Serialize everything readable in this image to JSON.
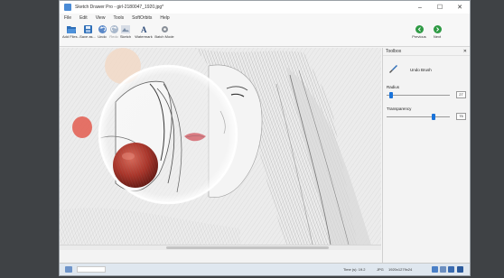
{
  "window": {
    "title": "Sketch Drawer Pro - girl-2180047_1920.jpg*",
    "controls": {
      "minimize": "–",
      "maximize": "☐",
      "close": "✕"
    }
  },
  "menu": [
    "File",
    "Edit",
    "View",
    "Tools",
    "SoftOrbits",
    "Help"
  ],
  "toolbar": {
    "add_files": "Add Files...",
    "save_as": "Save as...",
    "undo": "Undo",
    "redo": "Redo",
    "sketch": "Sketch",
    "watermark": "Watermark",
    "batch_mode": "Batch Mode",
    "previous": "Previous",
    "next": "Next"
  },
  "toolbox": {
    "title": "Toolbox",
    "close": "✕",
    "brush_name": "Undo Brush",
    "radius_label": "Radius",
    "radius_value": "27",
    "radius_level": 0.05,
    "transparency_label": "Transparency",
    "transparency_value": "75",
    "transparency_level": 0.75
  },
  "status": {
    "time": "Time (s): 19.2",
    "format": "JPG",
    "dimensions": "1920x1279x24"
  },
  "colors": {
    "accent": "#1a73d9",
    "nav_green": "#2e9a44",
    "desktop": "#3f4245",
    "status_bg": "#dfe7ef"
  },
  "icons": {
    "add_files": "folder-open-icon",
    "save_as": "save-icon",
    "undo": "undo-icon",
    "redo": "redo-icon",
    "sketch": "sketch-icon",
    "watermark": "watermark-icon",
    "batch_mode": "gear-icon",
    "previous": "arrow-left-circle-icon",
    "next": "arrow-right-circle-icon",
    "brush": "brush-icon"
  }
}
